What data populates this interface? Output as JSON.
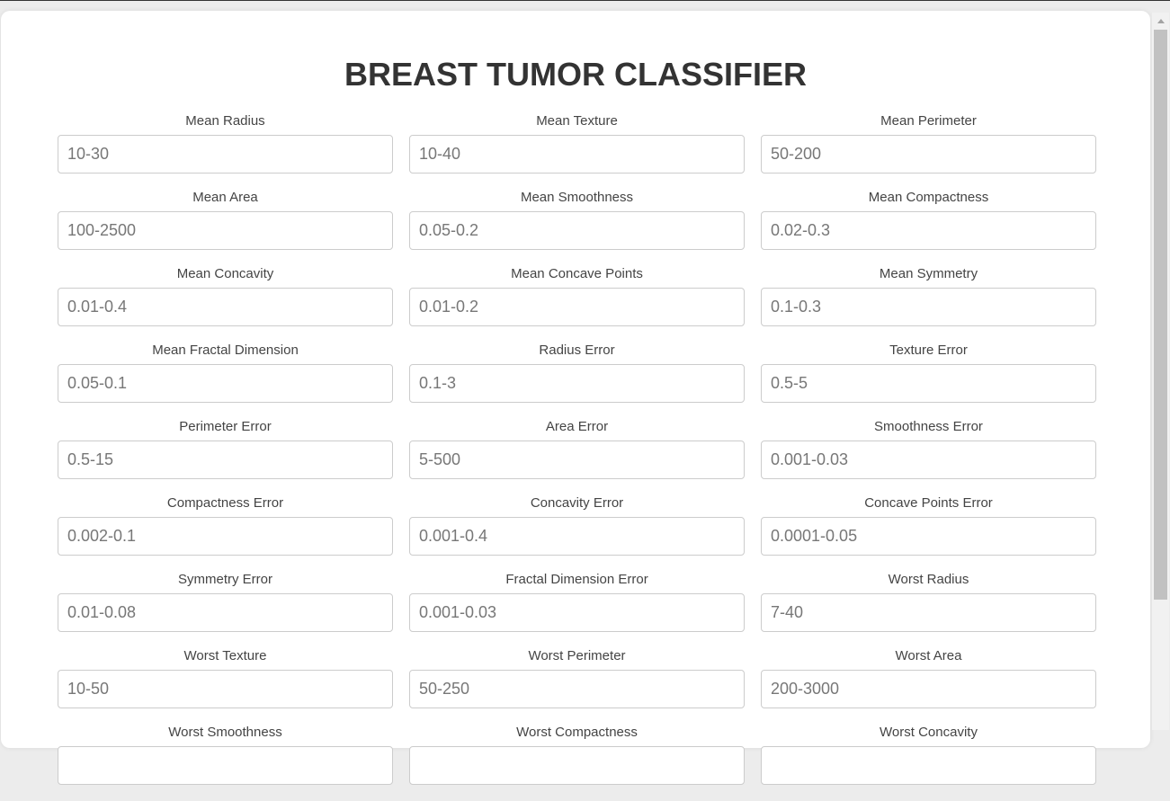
{
  "title": "BREAST TUMOR CLASSIFIER",
  "fields": [
    {
      "label": "Mean Radius",
      "placeholder": "10-30"
    },
    {
      "label": "Mean Texture",
      "placeholder": "10-40"
    },
    {
      "label": "Mean Perimeter",
      "placeholder": "50-200"
    },
    {
      "label": "Mean Area",
      "placeholder": "100-2500"
    },
    {
      "label": "Mean Smoothness",
      "placeholder": "0.05-0.2"
    },
    {
      "label": "Mean Compactness",
      "placeholder": "0.02-0.3"
    },
    {
      "label": "Mean Concavity",
      "placeholder": "0.01-0.4"
    },
    {
      "label": "Mean Concave Points",
      "placeholder": "0.01-0.2"
    },
    {
      "label": "Mean Symmetry",
      "placeholder": "0.1-0.3"
    },
    {
      "label": "Mean Fractal Dimension",
      "placeholder": "0.05-0.1"
    },
    {
      "label": "Radius Error",
      "placeholder": "0.1-3"
    },
    {
      "label": "Texture Error",
      "placeholder": "0.5-5"
    },
    {
      "label": "Perimeter Error",
      "placeholder": "0.5-15"
    },
    {
      "label": "Area Error",
      "placeholder": "5-500"
    },
    {
      "label": "Smoothness Error",
      "placeholder": "0.001-0.03"
    },
    {
      "label": "Compactness Error",
      "placeholder": "0.002-0.1"
    },
    {
      "label": "Concavity Error",
      "placeholder": "0.001-0.4"
    },
    {
      "label": "Concave Points Error",
      "placeholder": "0.0001-0.05"
    },
    {
      "label": "Symmetry Error",
      "placeholder": "0.01-0.08"
    },
    {
      "label": "Fractal Dimension Error",
      "placeholder": "0.001-0.03"
    },
    {
      "label": "Worst Radius",
      "placeholder": "7-40"
    },
    {
      "label": "Worst Texture",
      "placeholder": "10-50"
    },
    {
      "label": "Worst Perimeter",
      "placeholder": "50-250"
    },
    {
      "label": "Worst Area",
      "placeholder": "200-3000"
    },
    {
      "label": "Worst Smoothness",
      "placeholder": ""
    },
    {
      "label": "Worst Compactness",
      "placeholder": ""
    },
    {
      "label": "Worst Concavity",
      "placeholder": ""
    }
  ]
}
